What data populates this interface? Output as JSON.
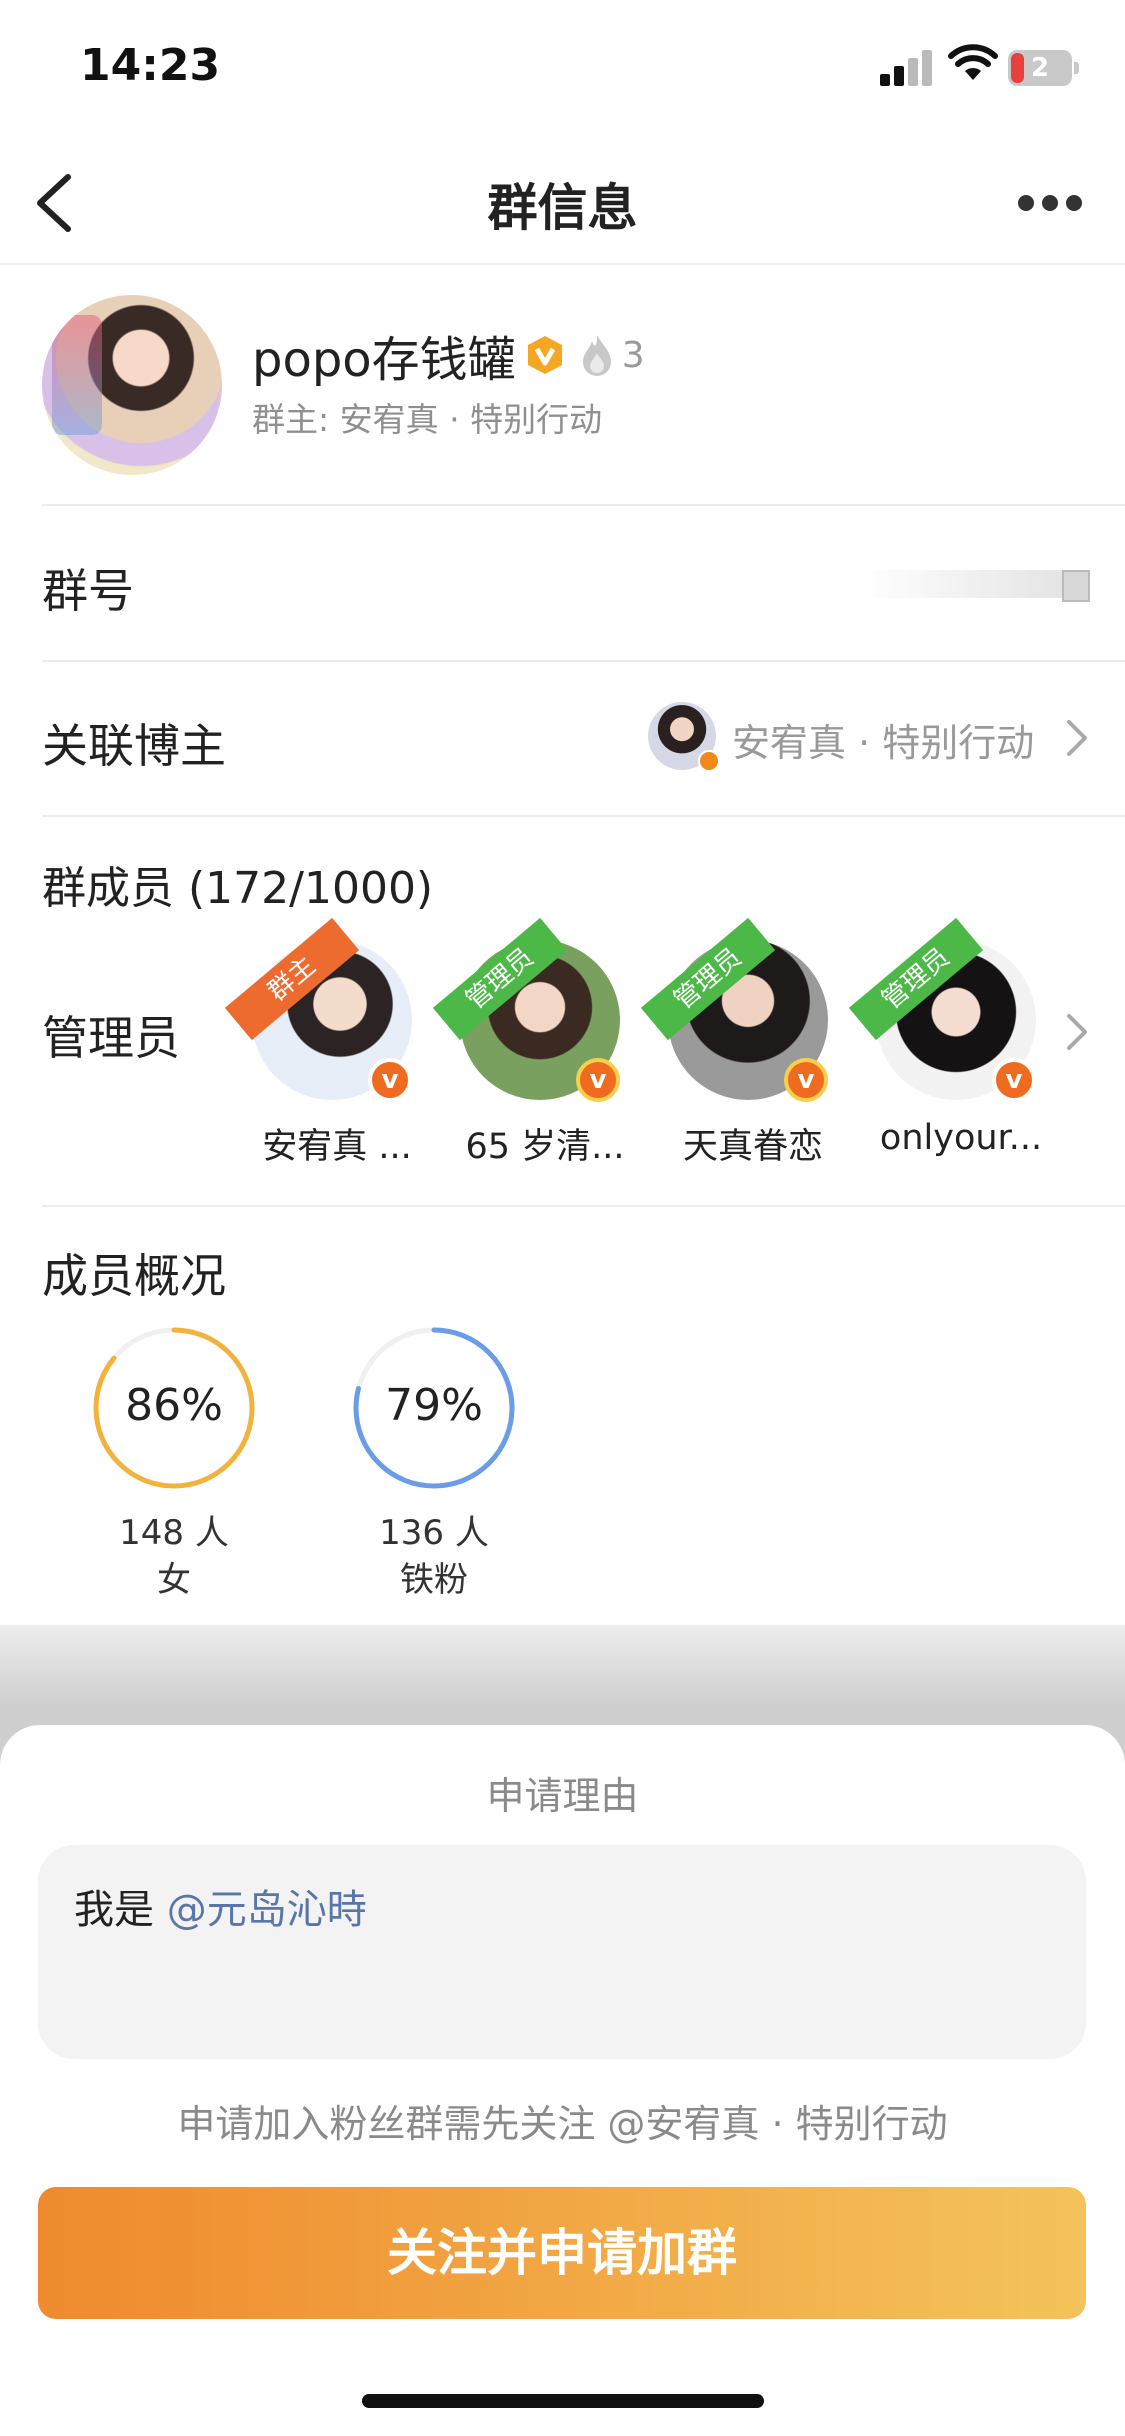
{
  "status_bar": {
    "time": "14:23",
    "battery": "2"
  },
  "nav": {
    "title": "群信息",
    "back_icon": "chevron-left-icon",
    "more_icon": "more-dots-icon"
  },
  "group": {
    "name": "popo存钱罐",
    "fire_count": "3",
    "owner": "群主: 安宥真 · 特别行动"
  },
  "rows": {
    "group_number_label": "群号",
    "blogger_label": "关联博主",
    "blogger_name": "安宥真 · 特别行动",
    "members_title": "群成员 (172/1000)",
    "admins_label": "管理员"
  },
  "admins": [
    {
      "role": "群主",
      "name": "安宥真 ...",
      "role_color": "#ee6b2f"
    },
    {
      "role": "管理员",
      "name": "65 岁清...",
      "role_color": "#4cb847"
    },
    {
      "role": "管理员",
      "name": "天真眷恋",
      "role_color": "#4cb847"
    },
    {
      "role": "管理员",
      "name": "onlyour...",
      "role_color": "#4cb847"
    }
  ],
  "overview": {
    "title": "成员概况",
    "stats": [
      {
        "percent": "86%",
        "fraction": 0.86,
        "count": "148 人",
        "label": "女",
        "color": "#f3b23c"
      },
      {
        "percent": "79%",
        "fraction": 0.79,
        "count": "136 人",
        "label": "铁粉",
        "color": "#6b9ce8"
      }
    ]
  },
  "sheet": {
    "title": "申请理由",
    "reason_prefix": "我是 ",
    "reason_mention": "@元岛沁時",
    "notice": "申请加入粉丝群需先关注 @安宥真 · 特别行动",
    "button": "关注并申请加群"
  }
}
